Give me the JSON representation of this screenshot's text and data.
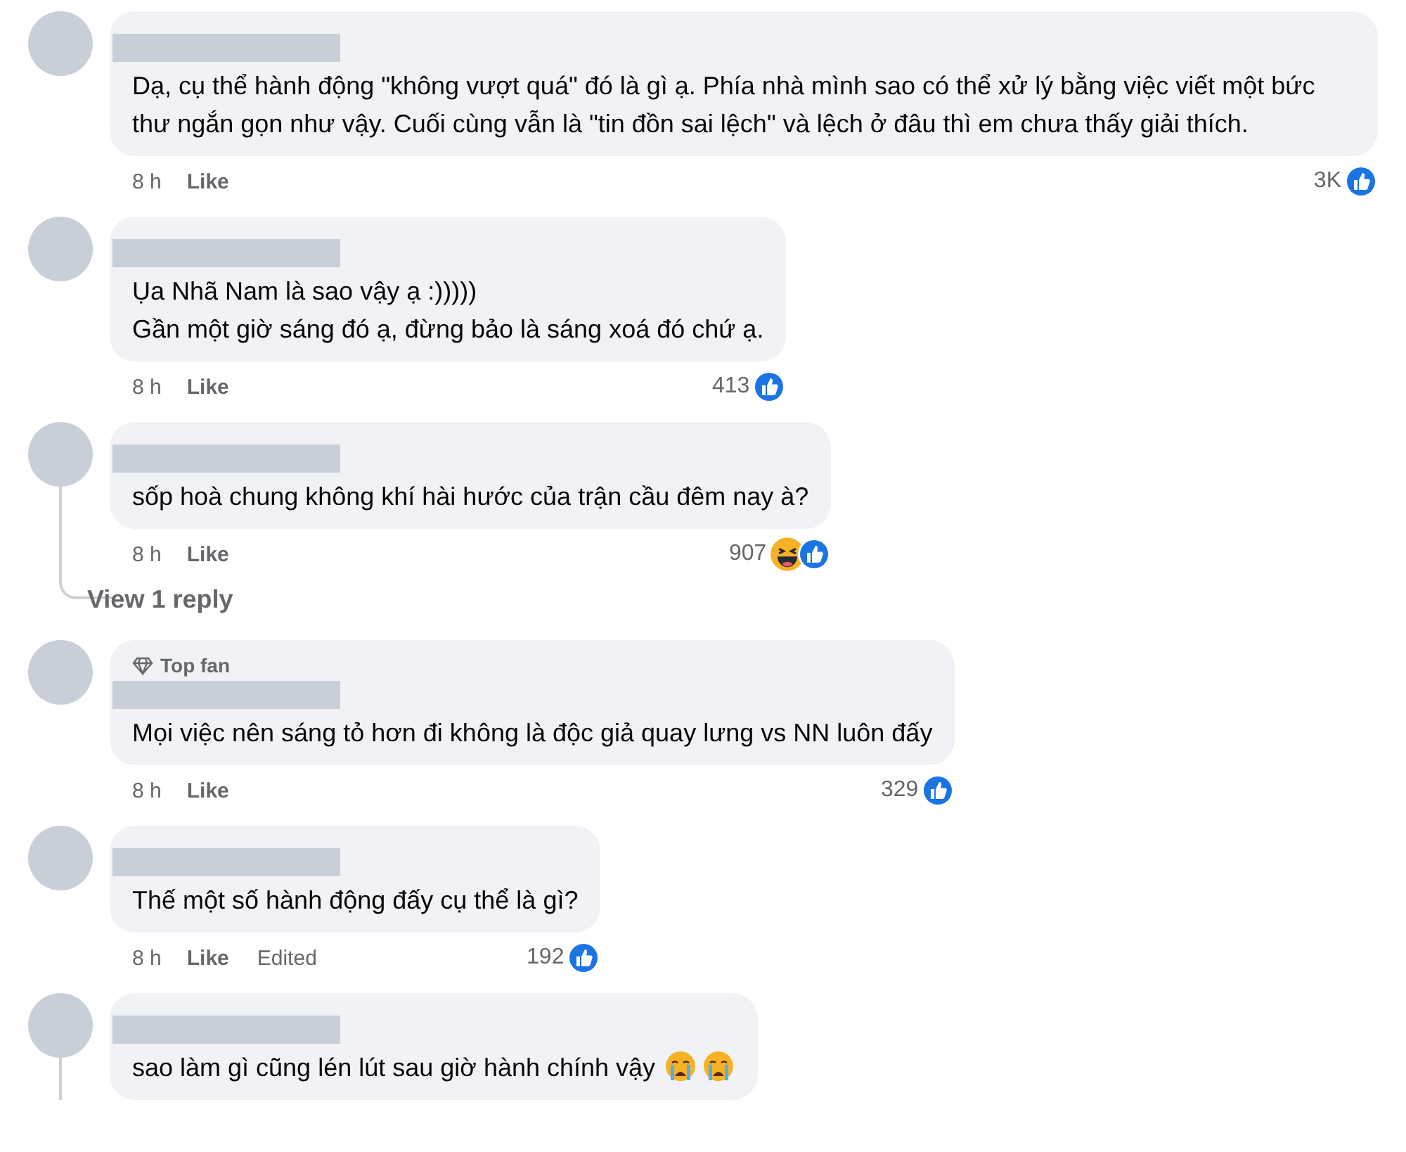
{
  "comments": [
    {
      "lines": [
        "Dạ, cụ thể hành động \"không vượt quá\" đó là gì ạ. Phía nhà mình sao có thể xử lý bằng việc viết một bức thư ngắn gọn như vậy. Cuối cùng vẫn là \"tin đồn sai lệch\" và lệch ở đâu thì em chưa thấy giải thích."
      ],
      "time": "8 h",
      "like": "Like",
      "reaction_count": "3K",
      "reactions": [
        {
          "kind": "like"
        }
      ],
      "thread": false
    },
    {
      "lines": [
        "Ụa Nhã Nam là sao vậy ạ :)))))",
        "Gần một giờ sáng đó ạ, đừng bảo là sáng xoá đó chứ ạ."
      ],
      "time": "8 h",
      "like": "Like",
      "reaction_count": "413",
      "reactions": [
        {
          "kind": "like"
        }
      ],
      "thread": false
    },
    {
      "lines": [
        "sốp hoà chung không khí hài hước của trận cầu đêm nay à?"
      ],
      "time": "8 h",
      "like": "Like",
      "reaction_count": "907",
      "reactions": [
        {
          "kind": "haha"
        },
        {
          "kind": "like"
        }
      ],
      "thread": true,
      "replies_link": "View 1 reply"
    },
    {
      "badge": "Top fan",
      "lines": [
        "Mọi việc nên sáng tỏ hơn đi không là độc giả quay lưng vs NN luôn đấy"
      ],
      "time": "8 h",
      "like": "Like",
      "reaction_count": "329",
      "reactions": [
        {
          "kind": "like"
        }
      ],
      "thread": false
    },
    {
      "lines": [
        "Thế một số hành động đấy cụ thể là gì?"
      ],
      "time": "8 h",
      "like": "Like",
      "edited": "Edited",
      "reaction_count": "192",
      "reactions": [
        {
          "kind": "like"
        }
      ],
      "thread": false
    },
    {
      "lines": [
        "sao làm gì cũng lén lút sau giờ hành chính vậy"
      ],
      "text_emojis": [
        {
          "kind": "crying"
        },
        {
          "kind": "crying"
        }
      ],
      "thread": true
    }
  ]
}
